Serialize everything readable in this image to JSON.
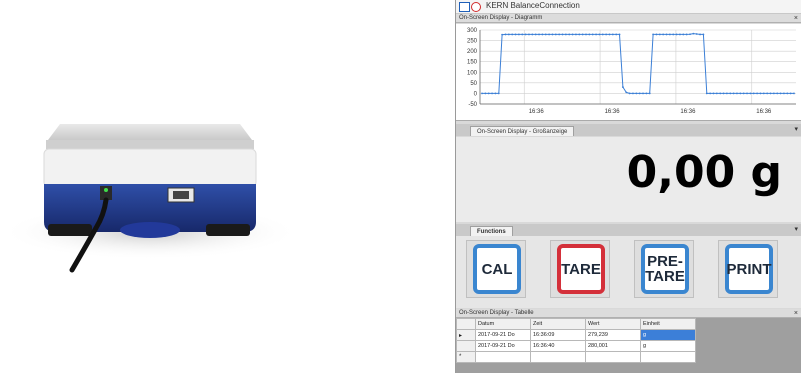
{
  "window": {
    "title": "KERN BalanceConnection",
    "icon_names": [
      "app-window-icon",
      "stop-icon"
    ]
  },
  "chart_panel": {
    "header": "On-Screen Display - Diagramm",
    "close_glyph": "×"
  },
  "chart_data": {
    "type": "line",
    "yticks": [
      "300",
      "250",
      "200",
      "150",
      "100",
      "50",
      "0",
      "-50"
    ],
    "xticks": [
      "16:36",
      "16:36",
      "16:36",
      "16:36"
    ],
    "ylim": [
      -50,
      300
    ],
    "grid": true,
    "series": [
      {
        "color": "#3b7fd6",
        "values": [
          0,
          0,
          0,
          0,
          0,
          0,
          278,
          279,
          279,
          279,
          279,
          279,
          279,
          279,
          279,
          279,
          279,
          279,
          279,
          279,
          279,
          279,
          279,
          279,
          279,
          279,
          279,
          279,
          279,
          279,
          279,
          279,
          279,
          279,
          279,
          279,
          279,
          279,
          279,
          279,
          279,
          279,
          30,
          5,
          0,
          0,
          0,
          0,
          0,
          0,
          0,
          279,
          279,
          279,
          279,
          279,
          279,
          279,
          279,
          279,
          279,
          279,
          280,
          283,
          281,
          279,
          279,
          0,
          0,
          0,
          0,
          0,
          0,
          0,
          0,
          0,
          0,
          0,
          0,
          0,
          0,
          0,
          0,
          0,
          0,
          0,
          0,
          0,
          0,
          0,
          0,
          0,
          0,
          0
        ]
      }
    ]
  },
  "display_panel": {
    "tab": "On-Screen Display - Großanzeige",
    "weight_value": "0,00 g",
    "menu_glyph": "▾"
  },
  "functions_panel": {
    "tab": "Functions",
    "menu_glyph": "▾",
    "buttons": [
      {
        "label": "CAL",
        "accent": "#3a86d0"
      },
      {
        "label": "TARE",
        "accent": "#d4303a"
      },
      {
        "label": "PRE-\nTARE",
        "accent": "#3a86d0"
      },
      {
        "label": "PRINT",
        "accent": "#3a86d0"
      }
    ]
  },
  "table_panel": {
    "header": "On-Screen Display - Tabelle",
    "close_glyph": "×",
    "columns": [
      "Datum",
      "Zeit",
      "Wert",
      "Einheit"
    ],
    "rows": [
      {
        "marker": "▸",
        "cells": [
          "2017-09-21 Do",
          "16:36:09",
          "279,239",
          "g"
        ]
      },
      {
        "marker": "",
        "cells": [
          "2017-09-21 Do",
          "16:36:40",
          "280,001",
          "g"
        ]
      },
      {
        "marker": "*",
        "cells": [
          "",
          "",
          "",
          ""
        ]
      }
    ]
  }
}
